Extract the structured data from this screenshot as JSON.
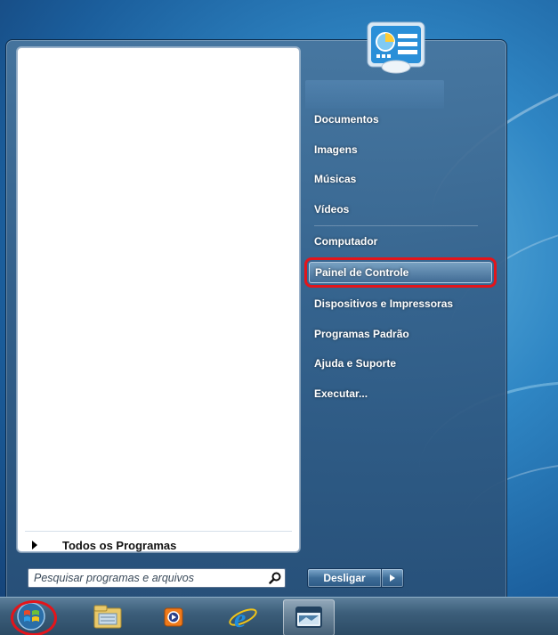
{
  "start_menu": {
    "left_pane": {
      "all_programs_label": "Todos os Programas",
      "search": {
        "placeholder": "Pesquisar programas e arquivos",
        "value": ""
      }
    },
    "right_pane": {
      "items": [
        {
          "label": "Documentos"
        },
        {
          "label": "Imagens"
        },
        {
          "label": "Músicas"
        },
        {
          "label": "Vídeos"
        },
        {
          "label": "Computador"
        },
        {
          "label": "Painel de Controle",
          "highlighted": true
        },
        {
          "label": "Dispositivos e Impressoras"
        },
        {
          "label": "Programas Padrão"
        },
        {
          "label": "Ajuda e Suporte"
        },
        {
          "label": "Executar..."
        }
      ]
    },
    "shutdown": {
      "label": "Desligar",
      "arrow_icon": "play-arrow-icon"
    }
  },
  "taskbar": {
    "buttons": [
      {
        "icon": "windows-start-orb-icon"
      },
      {
        "icon": "windows-explorer-icon"
      },
      {
        "icon": "media-player-icon"
      },
      {
        "icon": "internet-explorer-icon"
      },
      {
        "icon": "control-panel-window-icon",
        "active": true
      }
    ]
  },
  "colors": {
    "highlight_outline": "#e3151b",
    "menu_blue": "#34608a",
    "desktop_blue": "#2f86c4"
  }
}
